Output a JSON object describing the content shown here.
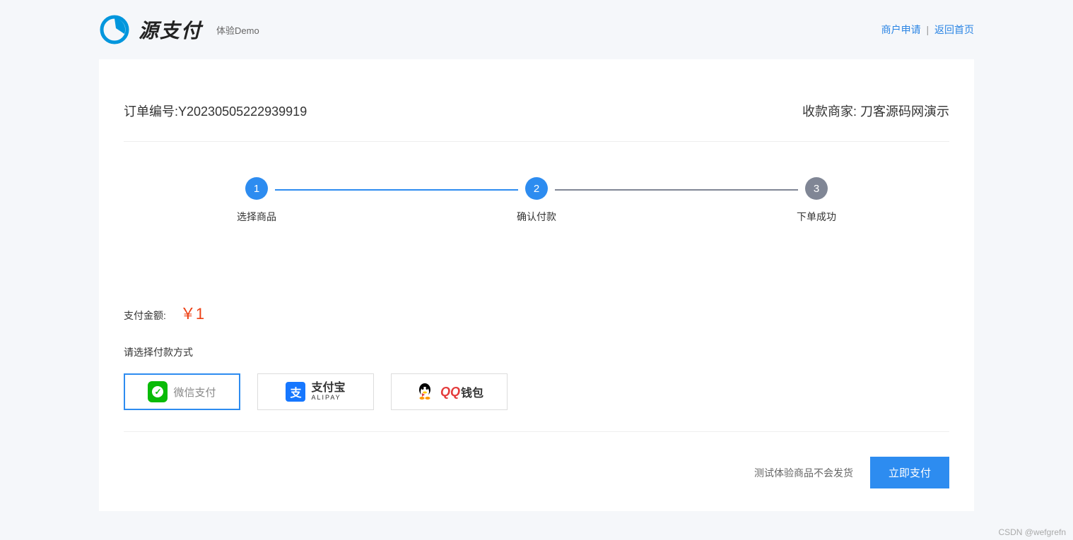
{
  "header": {
    "logo_text": "源支付",
    "demo_tag": "体验Demo",
    "link_merchant": "商户申请",
    "link_home": "返回首页",
    "separator": "|"
  },
  "order": {
    "order_label": "订单编号:",
    "order_number": "Y20230505222939919",
    "merchant_label": "收款商家:",
    "merchant_name": "刀客源码网演示"
  },
  "steps": [
    {
      "num": "1",
      "label": "选择商品",
      "state": "done"
    },
    {
      "num": "2",
      "label": "确认付款",
      "state": "current"
    },
    {
      "num": "3",
      "label": "下单成功",
      "state": "pending"
    }
  ],
  "amount": {
    "label": "支付金额:",
    "value": "￥1"
  },
  "payment": {
    "select_label": "请选择付款方式",
    "methods": [
      {
        "id": "wechat",
        "label": "微信支付",
        "selected": true
      },
      {
        "id": "alipay",
        "label_cn": "支付宝",
        "label_en": "ALIPAY",
        "selected": false
      },
      {
        "id": "qqwallet",
        "label_qq": "QQ",
        "label_wallet": "钱包",
        "selected": false
      }
    ]
  },
  "footer": {
    "notice": "测试体验商品不会发货",
    "pay_button": "立即支付"
  },
  "watermark": "CSDN @wefgrefn"
}
